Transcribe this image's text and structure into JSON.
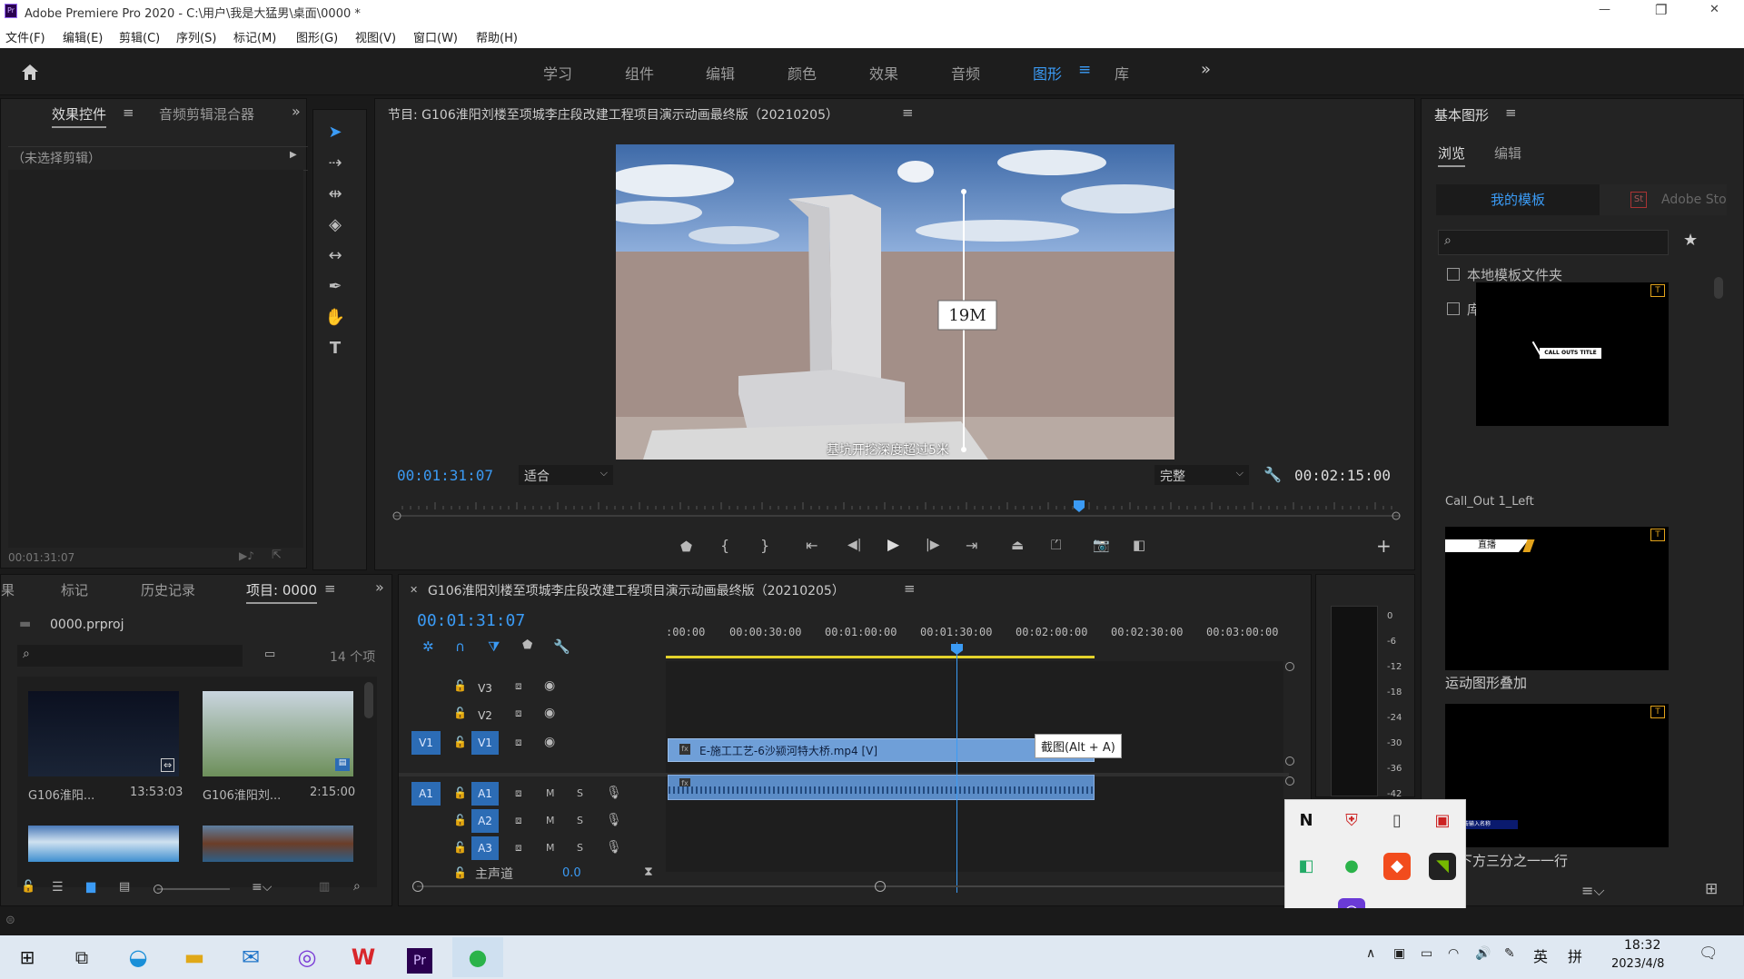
{
  "window": {
    "title": "Adobe Premiere Pro 2020 - C:\\用户\\我是大猛男\\桌面\\0000 *",
    "minimize": "—",
    "restore": "❐",
    "close": "✕"
  },
  "menu": [
    "文件(F)",
    "编辑(E)",
    "剪辑(C)",
    "序列(S)",
    "标记(M)",
    "图形(G)",
    "视图(V)",
    "窗口(W)",
    "帮助(H)"
  ],
  "workspaces": [
    "学习",
    "组件",
    "编辑",
    "颜色",
    "效果",
    "音频",
    "图形",
    "库"
  ],
  "workspace_active": "图形",
  "left_panel": {
    "tabs": [
      "效果控件",
      "音频剪辑混合器"
    ],
    "placeholder": "（未选择剪辑）",
    "timecode": "00:01:31:07"
  },
  "program": {
    "title": "节目: G106淮阳刘楼至项城李庄段改建工程项目演示动画最终版（20210205）",
    "label": "19M",
    "subtitle": "基坑开挖深度超过5米",
    "timecode_in": "00:01:31:07",
    "fit": "适合",
    "quality": "完整",
    "timecode_dur": "00:02:15:00"
  },
  "project": {
    "tabs": [
      "果",
      "标记",
      "历史记录",
      "项目: 0000"
    ],
    "file": "0000.prproj",
    "count": "14 个项",
    "items": [
      {
        "name": "G106淮阳...",
        "dur": "13:53:03"
      },
      {
        "name": "G106淮阳刘...",
        "dur": "2:15:00"
      }
    ]
  },
  "timeline": {
    "title": "G106淮阳刘楼至项城李庄段改建工程项目演示动画最终版（20210205）",
    "timecode": "00:01:31:07",
    "ruler": [
      ":00:00",
      "00:00:30:00",
      "00:01:00:00",
      "00:01:30:00",
      "00:02:00:00",
      "00:02:30:00",
      "00:03:00:00"
    ],
    "video_tracks": [
      {
        "name": "V3"
      },
      {
        "name": "V2"
      },
      {
        "name": "V1",
        "src": "V1"
      }
    ],
    "audio_tracks": [
      {
        "name": "A1",
        "src": "A1"
      },
      {
        "name": "A2"
      },
      {
        "name": "A3"
      }
    ],
    "master": "主声道",
    "master_val": "0.0",
    "clip": "E-施工工艺-6沙颍河特大桥.mp4 [V]",
    "tooltip": "截图(Alt + A)"
  },
  "meter": [
    "0",
    "-6",
    "-12",
    "-18",
    "-24",
    "-30",
    "-36",
    "-42"
  ],
  "egp": {
    "title": "基本图形",
    "tabs": [
      "浏览",
      "编辑"
    ],
    "my_templates": "我的模板",
    "adobe_stock": "Adobe Sto",
    "local_folder": "本地模板文件夹",
    "library": "库",
    "templates": [
      "Call_Out 1_Left",
      "运动图形叠加",
      "中下方三分之一一行"
    ],
    "callout_text": "CALL OUTS TITLE",
    "live": "直播",
    "lower_third_text": "点击输入名称"
  },
  "taskbar": {
    "time": "18:32",
    "date": "2023/4/8",
    "lang": "英",
    "ime": "拼"
  },
  "colors": {
    "accent": "#3b9bf5",
    "clip": "#6f9fd8",
    "yellow": "#e3d22b"
  }
}
